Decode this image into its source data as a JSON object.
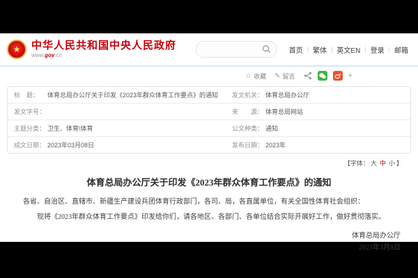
{
  "header": {
    "site_title": "中华人民共和国中央人民政府",
    "url_prefix": "www.",
    "url_gov": "gov",
    "url_suffix": ".cn",
    "search_value": "",
    "nav": {
      "home": "首页",
      "traditional": "繁体",
      "english": "英文EN",
      "login": "登录",
      "mail": "邮箱"
    }
  },
  "toolbar": {
    "favorite": "收藏",
    "comment": "留言",
    "favorite_icon": "☆",
    "comment_icon": "✎",
    "more": "+"
  },
  "meta_table": {
    "rows": [
      {
        "l_label": "标　题：",
        "l_value": "体育总局办公厅关于印发《2023年群众体育工作要点》的通知",
        "r_label": "发文机关：",
        "r_value": "体育总局办公厅"
      },
      {
        "l_label": "发文字号：",
        "l_value": "",
        "r_label": "来　　源：",
        "r_value": "体育总局网站"
      },
      {
        "l_label": "主题分类：",
        "l_value": "卫生、体育\\体育",
        "r_label": "公文种类：",
        "r_value": "通知"
      },
      {
        "l_label": "成文日期：",
        "l_value": "2023年03月08日",
        "r_label": "发布日期：",
        "r_value": "2023年"
      }
    ]
  },
  "font_control": {
    "prefix": "【字体：",
    "large": "大",
    "medium": "中",
    "small": "小",
    "suffix": "】"
  },
  "article": {
    "title": "体育总局办公厅关于印发《2023年群众体育工作要点》的通知",
    "p1": "各省、自治区、直辖市、新疆生产建设兵团体育行政部门，各司、局，各直属单位，有关全国性体育社会组织：",
    "p2": "现将《2023年群众体育工作要点》印发给你们，请各地区、各部门、各单位结合实际开展好工作，做好贯彻落实。",
    "sign_org": "体育总局办公厅",
    "sign_date": "2023年3月8日"
  },
  "colors": {
    "brand_red": "#c7000a",
    "wechat_green": "#3eb544",
    "weibo_red": "#e6542e",
    "header_border_blue": "#d8e7f5"
  }
}
